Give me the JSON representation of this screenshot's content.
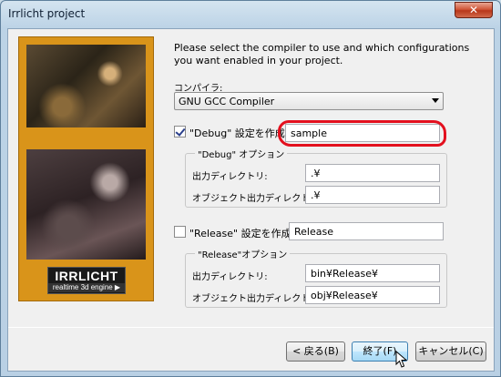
{
  "window": {
    "title": "Irrlicht project",
    "close_glyph": "✕"
  },
  "side_panel": {
    "logo_main": "IRRLICHT",
    "logo_sub": "realtime 3d engine ▶"
  },
  "intro": {
    "line1": "Please select the compiler to use and which configurations",
    "line2": "you want enabled in your project."
  },
  "compiler": {
    "label": "コンパイラ:",
    "value": "GNU GCC Compiler"
  },
  "debug": {
    "checked": true,
    "checkbox_label": "\"Debug\" 設定を作成",
    "name_value": "sample",
    "group_title": "\"Debug\" オプション",
    "output_dir_label": "出力ディレクトリ:",
    "output_dir_value": ".¥",
    "object_dir_label": "オブジェクト出力ディレクトリ:",
    "object_dir_value": ".¥"
  },
  "release": {
    "checked": false,
    "checkbox_label": "\"Release\" 設定を作成",
    "name_value": "Release",
    "group_title": "\"Release\"オプション",
    "output_dir_label": "出力ディレクトリ:",
    "output_dir_value": "bin¥Release¥",
    "object_dir_label": "オブジェクト出力ディレクトリ:",
    "object_dir_value": "obj¥Release¥"
  },
  "buttons": {
    "back": "< 戻る(B)",
    "finish": "終了(F)",
    "cancel": "キャンセル(C)"
  },
  "colors": {
    "highlight_ring": "#e3101e",
    "panel": "#d9941a"
  }
}
